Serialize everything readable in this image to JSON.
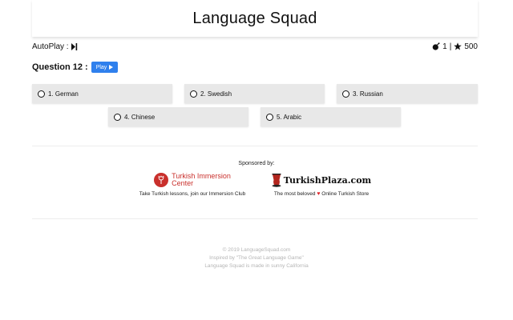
{
  "header": {
    "title": "Language Squad"
  },
  "topbar": {
    "autoplay_label": "AutoPlay :",
    "bombs": "1",
    "separator": "|",
    "stars": "500"
  },
  "question": {
    "title": "Question 12 :",
    "play_label": "Play"
  },
  "options": [
    {
      "label": "1. German"
    },
    {
      "label": "2. Swedish"
    },
    {
      "label": "3. Russian"
    },
    {
      "label": "4. Chinese"
    },
    {
      "label": "5. Arabic"
    }
  ],
  "sponsors": {
    "label": "Sponsored by:",
    "turkish_immersion": {
      "logo_line1": "Turkish Immersion",
      "logo_line2": "Center",
      "caption": "Take Turkish lessons, join our Immersion Club"
    },
    "turkish_plaza": {
      "logo_text": "TurkishPlaza.com",
      "caption_before": "The most beloved",
      "caption_after": "Online Turkish Store"
    }
  },
  "footer": {
    "copyright": "© 2019 LanguageSquad.com",
    "inspired": "Inspired by \"The Great Language Game\"",
    "made_in": "Language Squad is made in sunny California"
  },
  "colors": {
    "accent": "#2f80ed",
    "option_bg": "#e8e8e8",
    "brand_red": "#c9302c",
    "heart": "#e0252a"
  }
}
